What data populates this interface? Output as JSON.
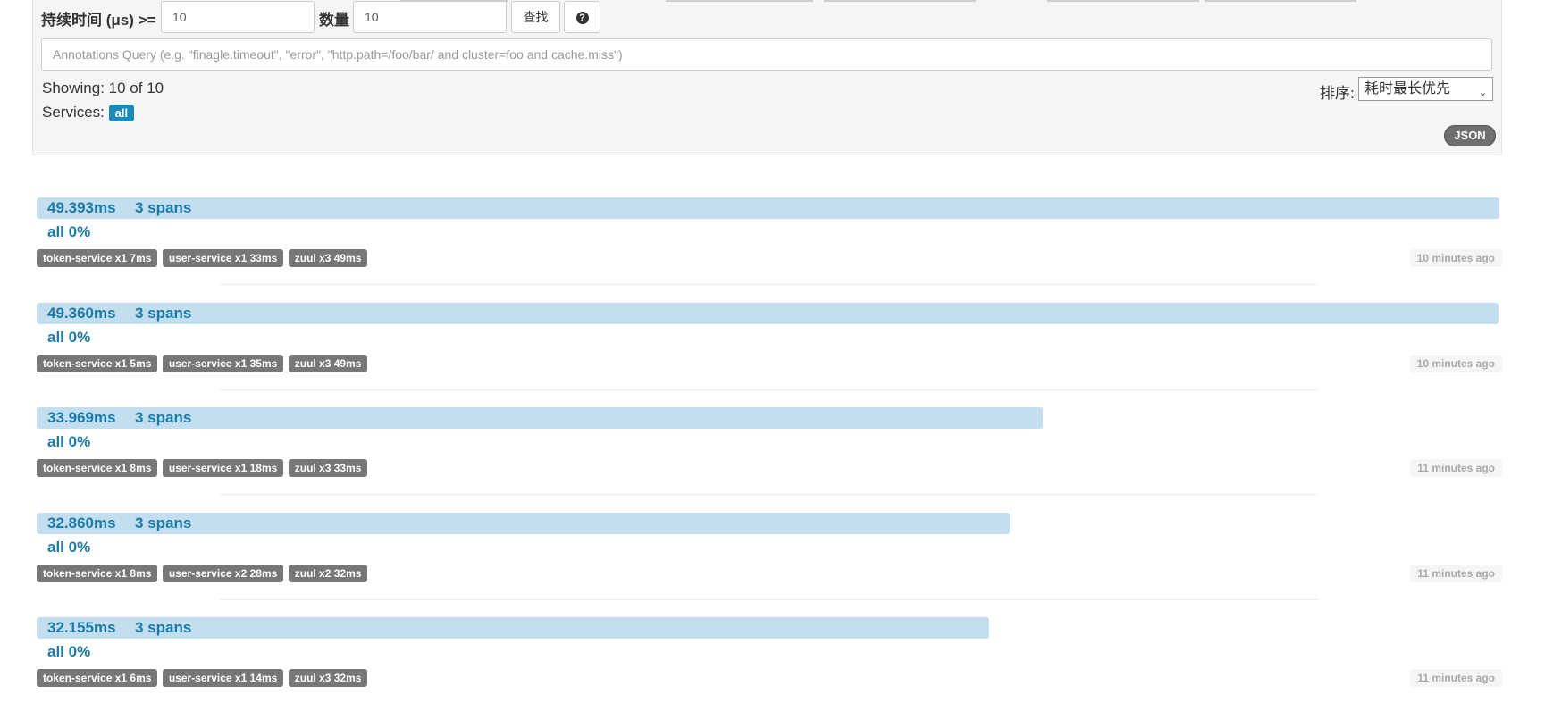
{
  "search": {
    "duration_label": "持续时间 (μs) >=",
    "duration_value": "10",
    "limit_label": "数量",
    "limit_value": "10",
    "find_button": "查找",
    "help_icon": "question-circle-icon",
    "help_glyph": "?",
    "annotations_placeholder": "Annotations Query (e.g. \"finagle.timeout\", \"error\", \"http.path=/foo/bar/ and cluster=foo and cache.miss\")"
  },
  "results": {
    "showing_text": "Showing: 10 of 10",
    "services_label": "Services:",
    "services_badge": "all",
    "sort_label": "排序:",
    "sort_selected": "耗时最长优先",
    "json_button": "JSON"
  },
  "colors": {
    "bar": "#c3dfef",
    "link_text": "#1a7aa8",
    "badge_bg": "#777777",
    "all_badge_bg": "#1a8ab8"
  },
  "traces": [
    {
      "duration": "49.393ms",
      "spans": "3 spans",
      "pct_label": "all 0%",
      "bar_fraction": 1.0,
      "services": [
        "token-service x1 7ms",
        "user-service x1 33ms",
        "zuul x3 49ms"
      ],
      "ago": "10 minutes ago"
    },
    {
      "duration": "49.360ms",
      "spans": "3 spans",
      "pct_label": "all 0%",
      "bar_fraction": 0.9993,
      "services": [
        "token-service x1 5ms",
        "user-service x1 35ms",
        "zuul x3 49ms"
      ],
      "ago": "10 minutes ago"
    },
    {
      "duration": "33.969ms",
      "spans": "3 spans",
      "pct_label": "all 0%",
      "bar_fraction": 0.6877,
      "services": [
        "token-service x1 8ms",
        "user-service x1 18ms",
        "zuul x3 33ms"
      ],
      "ago": "11 minutes ago"
    },
    {
      "duration": "32.860ms",
      "spans": "3 spans",
      "pct_label": "all 0%",
      "bar_fraction": 0.6653,
      "services": [
        "token-service x1 8ms",
        "user-service x2 28ms",
        "zuul x2 32ms"
      ],
      "ago": "11 minutes ago"
    },
    {
      "duration": "32.155ms",
      "spans": "3 spans",
      "pct_label": "all 0%",
      "bar_fraction": 0.651,
      "services": [
        "token-service x1 6ms",
        "user-service x1 14ms",
        "zuul x3 32ms"
      ],
      "ago": "11 minutes ago"
    }
  ]
}
